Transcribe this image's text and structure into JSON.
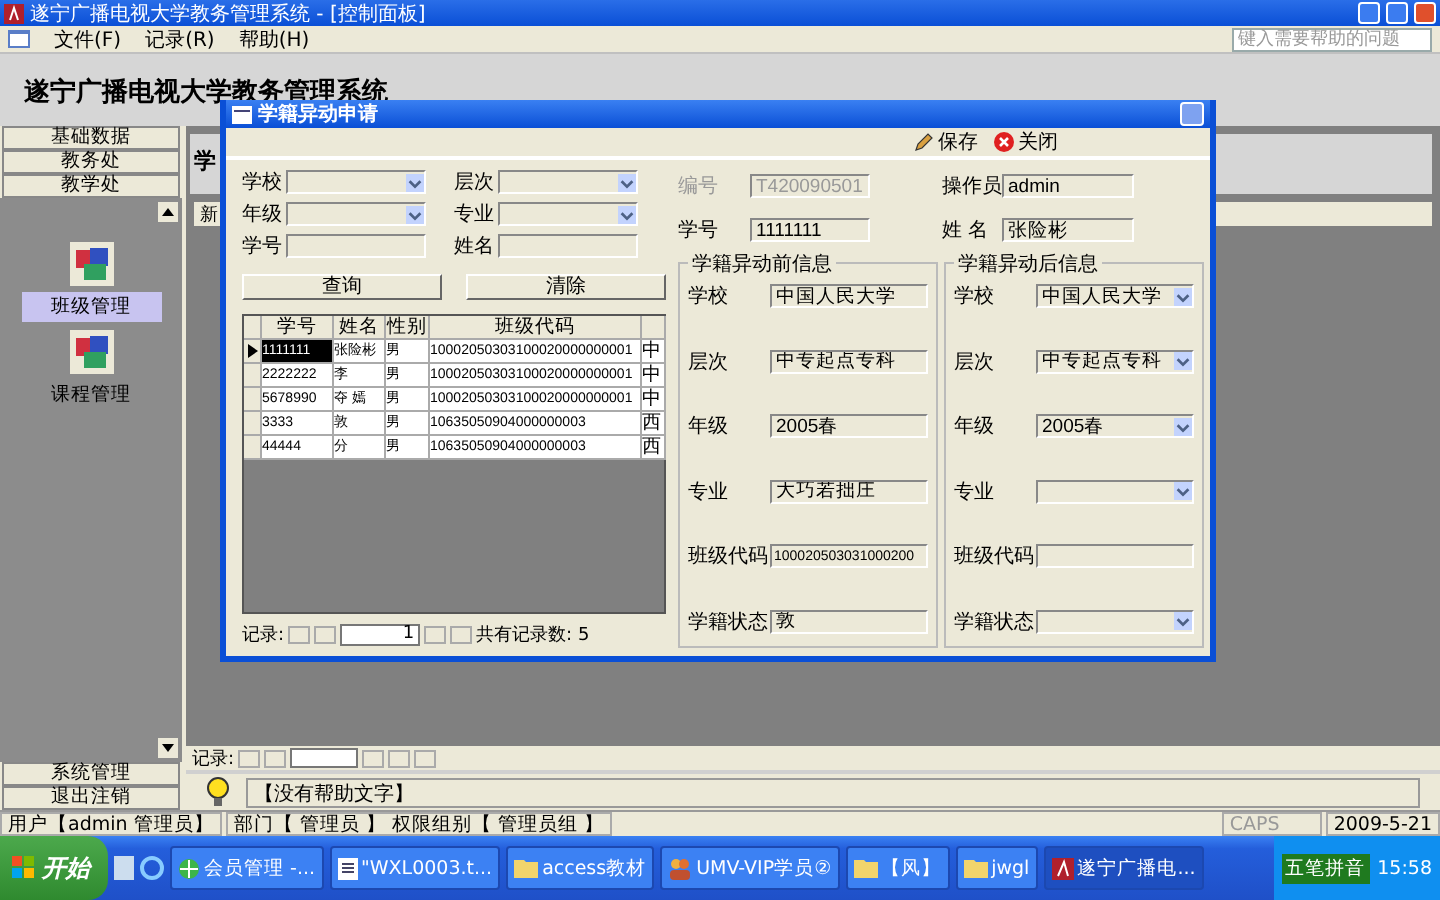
{
  "window": {
    "title": "遂宁广播电视大学教务管理系统 - [控制面板]"
  },
  "menu": [
    "文件(F)",
    "记录(R)",
    "帮助(H)"
  ],
  "help_search": {
    "placeholder": "键入需要帮助的问题"
  },
  "app_title": "遂宁广播电视大学教务管理系统",
  "sidebar": {
    "top_buttons": [
      "基础数据",
      "教务处",
      "教学处"
    ],
    "items": [
      {
        "label": "班级管理",
        "selected": true
      },
      {
        "label": "课程管理",
        "selected": false
      }
    ],
    "bottom_buttons": [
      "系统管理",
      "退出注销"
    ]
  },
  "background_form": {
    "heading": "学",
    "toolbar_label": "新",
    "record_label": "记录:",
    "help_text": "【没有帮助文字】"
  },
  "dialog": {
    "title": "学籍异动申请",
    "save": "保存",
    "close": "关闭",
    "search": [
      {
        "label": "学校",
        "kind": "combo"
      },
      {
        "label": "层次",
        "kind": "combo"
      },
      {
        "label": "年级",
        "kind": "combo"
      },
      {
        "label": "专业",
        "kind": "combo"
      },
      {
        "label": "学号",
        "kind": "text"
      },
      {
        "label": "姓名",
        "kind": "text"
      }
    ],
    "query_button": "查询",
    "clear_button": "清除",
    "grid": {
      "columns": [
        "学号",
        "姓名",
        "性别",
        "班级代码"
      ],
      "rows": [
        {
          "cells": [
            "1111111",
            "张险彬",
            "男",
            "10002050303100020000000001",
            "中"
          ],
          "selected": true
        },
        {
          "cells": [
            "2222222",
            "李",
            "男",
            "10002050303100020000000001",
            "中"
          ],
          "selected": false
        },
        {
          "cells": [
            "5678990",
            "夺 嫣",
            "男",
            "10002050303100020000000001",
            "中"
          ],
          "selected": false
        },
        {
          "cells": [
            "3333",
            "敦",
            "男",
            "10635050904000000003",
            "西"
          ],
          "selected": false
        },
        {
          "cells": [
            "44444",
            "分",
            "男",
            "10635050904000000003",
            "西"
          ],
          "selected": false
        }
      ]
    },
    "nav": {
      "label": "记录:",
      "current": "1",
      "total": "共有记录数: 5"
    },
    "header_fields": [
      {
        "label": "编号",
        "value": "T420090501",
        "disabled": true
      },
      {
        "label": "操作员",
        "value": "admin",
        "disabled": false
      },
      {
        "label": "学号",
        "value": "1111111",
        "disabled": false
      },
      {
        "label": "姓 名",
        "value": "张险彬",
        "disabled": false
      }
    ],
    "groups": [
      {
        "title": "学籍异动前信息",
        "fields": [
          {
            "label": "学校",
            "kind": "text",
            "value": "中国人民大学"
          },
          {
            "label": "层次",
            "kind": "text",
            "value": "中专起点专科"
          },
          {
            "label": "年级",
            "kind": "text",
            "value": "2005春"
          },
          {
            "label": "专业",
            "kind": "text",
            "value": "大巧若拙庄"
          },
          {
            "label": "班级代码",
            "kind": "text",
            "value": "100020503031000200"
          },
          {
            "label": "学籍状态",
            "kind": "text",
            "value": "敦"
          }
        ]
      },
      {
        "title": "学籍异动后信息",
        "fields": [
          {
            "label": "学校",
            "kind": "combo",
            "value": "中国人民大学"
          },
          {
            "label": "层次",
            "kind": "combo",
            "value": "中专起点专科"
          },
          {
            "label": "年级",
            "kind": "combo",
            "value": "2005春"
          },
          {
            "label": "专业",
            "kind": "combo"
          },
          {
            "label": "班级代码",
            "kind": "text"
          },
          {
            "label": "学籍状态",
            "kind": "combo"
          }
        ]
      }
    ]
  },
  "status_bar": {
    "user": "用户【admin 管理员】",
    "department": "部门【 管理员 】 权限组别【 管理员组 】",
    "caps": "CAPS",
    "date": "2009-5-21"
  },
  "taskbar": {
    "start": "开始",
    "tasks": [
      {
        "label": "会员管理 -...",
        "kind": "browser",
        "selected": false
      },
      {
        "label": "\"WXL0003.t...",
        "kind": "document",
        "selected": false
      },
      {
        "label": "access教材",
        "kind": "folder",
        "selected": false
      },
      {
        "label": "UMV-VIP学员②",
        "kind": "people",
        "selected": false
      },
      {
        "label": "【风】",
        "kind": "folder",
        "selected": false
      },
      {
        "label": "jwgl",
        "kind": "folder",
        "selected": false
      },
      {
        "label": "遂宁广播电...",
        "kind": "access",
        "selected": true
      }
    ],
    "ime": "五笔拼音",
    "clock": "15:58"
  }
}
